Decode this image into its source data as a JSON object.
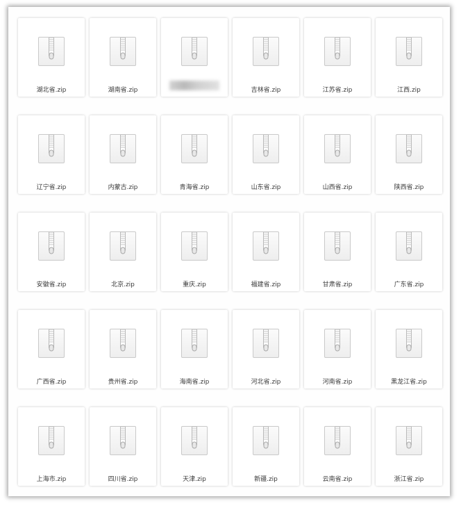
{
  "files": [
    {
      "name": "湖北省.zip"
    },
    {
      "name": "湖南省.zip"
    },
    {
      "name": "",
      "redacted": true
    },
    {
      "name": "吉林省.zip"
    },
    {
      "name": "江苏省.zip"
    },
    {
      "name": "江西.zip"
    },
    {
      "name": "辽宁省.zip"
    },
    {
      "name": "内蒙古.zip"
    },
    {
      "name": "青海省.zip"
    },
    {
      "name": "山东省.zip"
    },
    {
      "name": "山西省.zip"
    },
    {
      "name": "陕西省.zip"
    },
    {
      "name": "安徽省.zip"
    },
    {
      "name": "北京.zip"
    },
    {
      "name": "重庆.zip"
    },
    {
      "name": "福建省.zip"
    },
    {
      "name": "甘肃省.zip"
    },
    {
      "name": "广东省.zip"
    },
    {
      "name": "广西省.zip"
    },
    {
      "name": "贵州省.zip"
    },
    {
      "name": "海南省.zip"
    },
    {
      "name": "河北省.zip"
    },
    {
      "name": "河南省.zip"
    },
    {
      "name": "黑龙江省.zip"
    },
    {
      "name": "上海市.zip"
    },
    {
      "name": "四川省.zip"
    },
    {
      "name": "天津.zip"
    },
    {
      "name": "新疆.zip"
    },
    {
      "name": "云南省.zip"
    },
    {
      "name": "浙江省.zip"
    }
  ],
  "icon": "zip-archive-icon"
}
